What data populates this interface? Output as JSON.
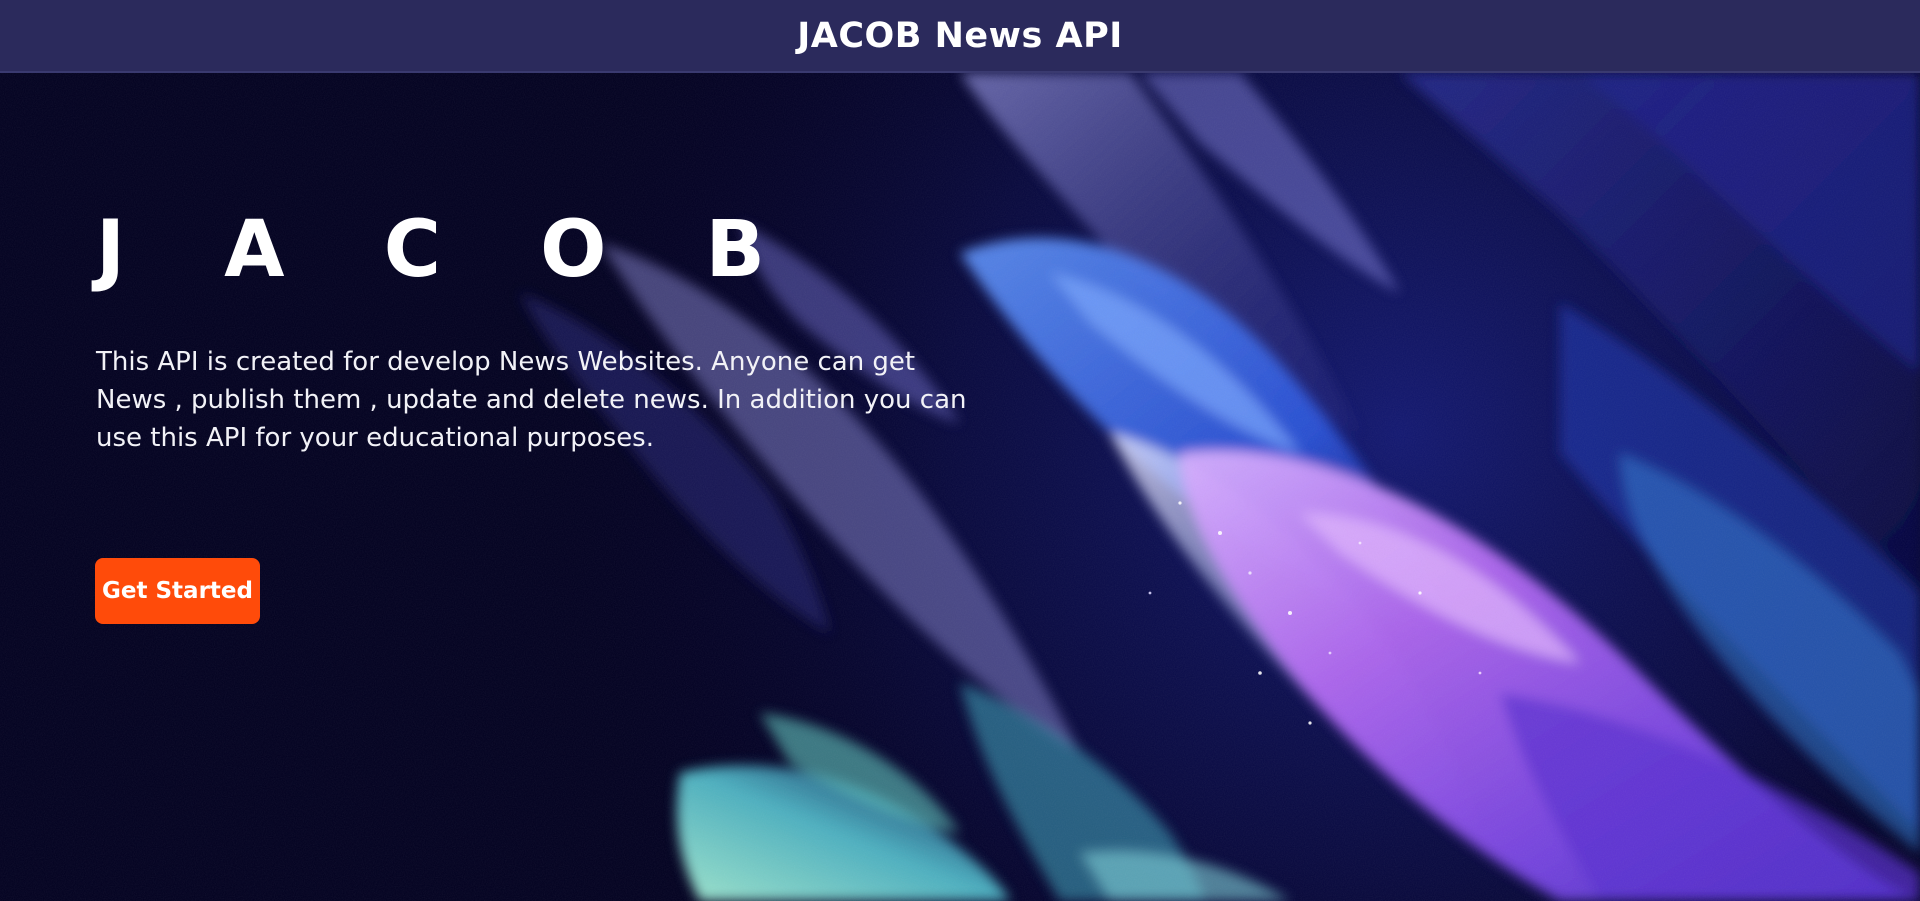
{
  "header": {
    "title": "JACOB News API"
  },
  "hero": {
    "brand": "J A C O B",
    "description": "This API is created for develop News Websites. Anyone can get News , publish them , update and delete news. In addition you can use this API for your educational purposes.",
    "cta_label": "Get Started",
    "artwork": "abstract-color-splash-illustration"
  },
  "colors": {
    "header_background": "#2b2a5c",
    "page_background": "#020020",
    "cta_background": "#ff4b0a",
    "text": "#ffffff"
  }
}
